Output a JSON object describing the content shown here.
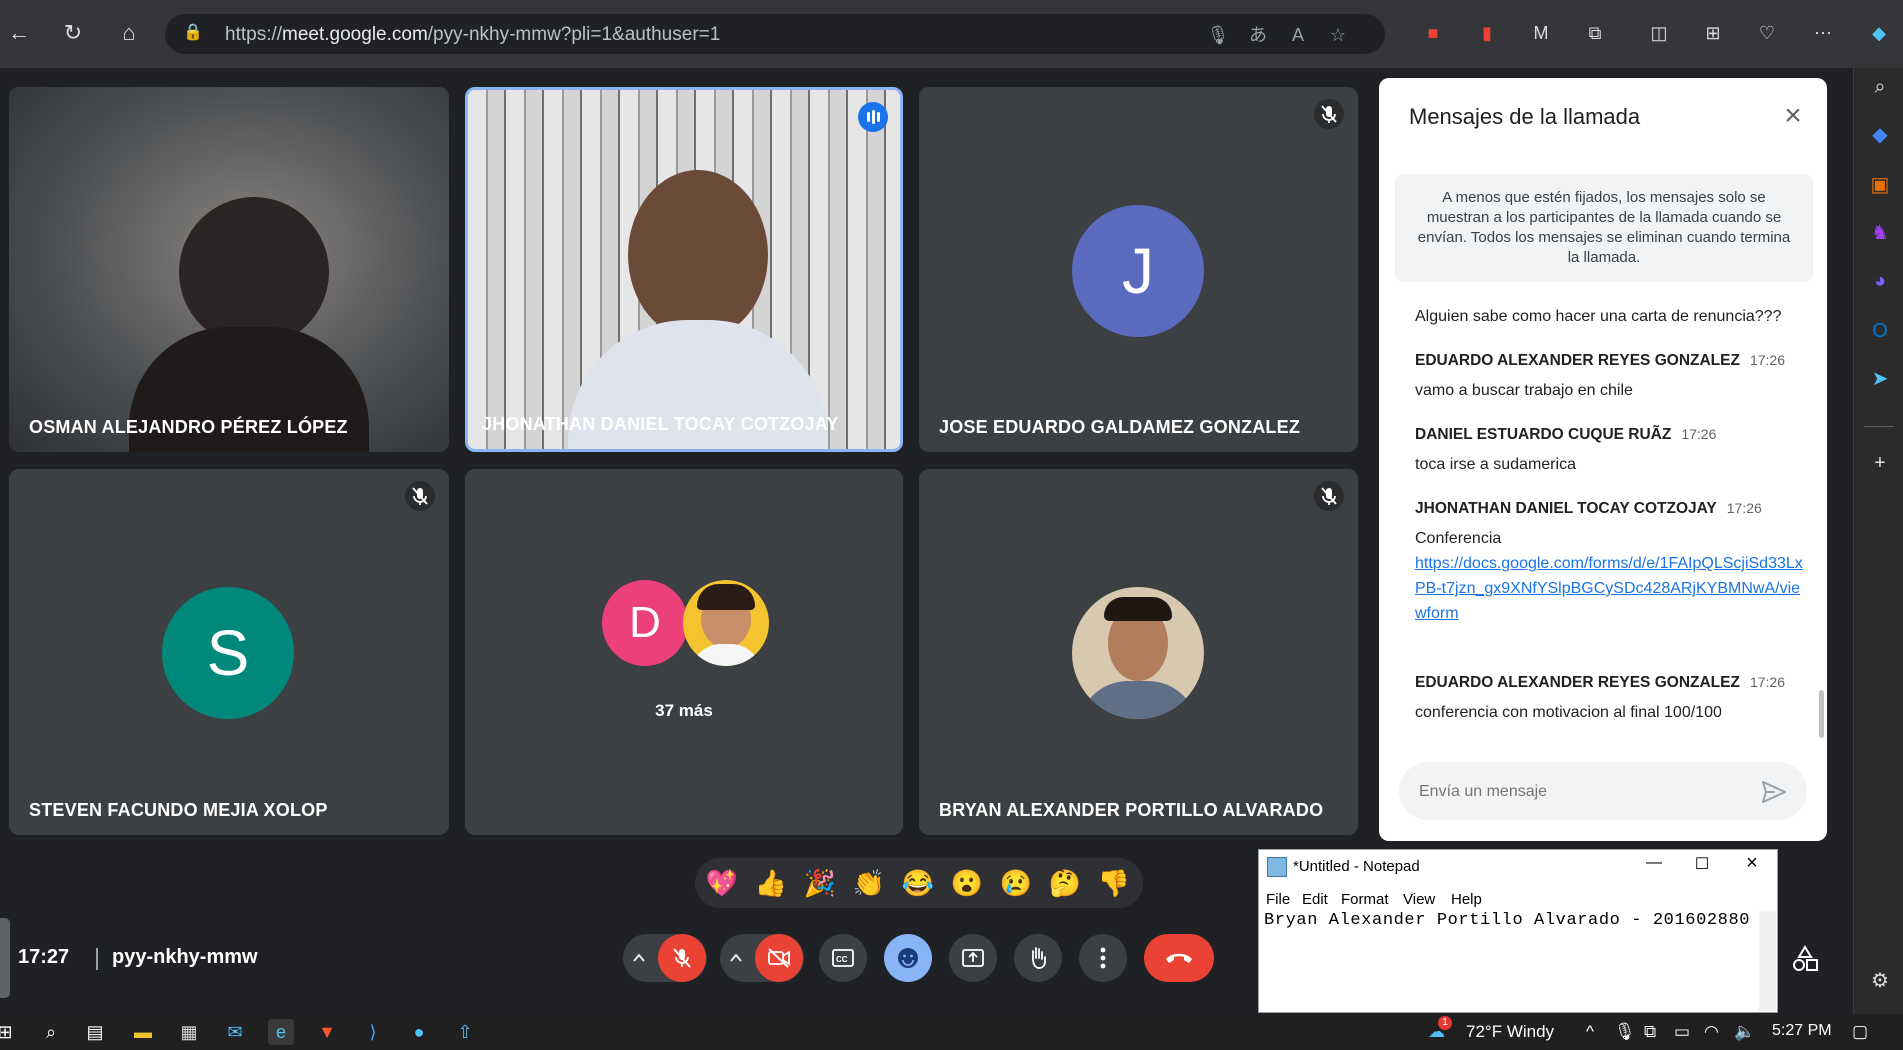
{
  "browser": {
    "url_prefix": "https://",
    "url_host": "meet.google.com",
    "url_path": "/pyy-nkhy-mmw?pli=1&authuser=1"
  },
  "participants": [
    {
      "name": "OSMAN ALEJANDRO PÉREZ LÓPEZ",
      "type": "video"
    },
    {
      "name": "JHONATHAN DANIEL TOCAY COTZOJAY",
      "type": "video",
      "speaking": true
    },
    {
      "name": "JOSE EDUARDO GALDAMEZ GONZALEZ",
      "type": "avatar",
      "initial": "J",
      "color": "#5c6bc0",
      "muted": true
    },
    {
      "name": "STEVEN FACUNDO MEJIA XOLOP",
      "type": "avatar",
      "initial": "S",
      "color": "#00897b",
      "muted": true
    },
    {
      "name": "",
      "type": "group",
      "initial": "D",
      "color": "#ec407a",
      "more_label": "37 más"
    },
    {
      "name": "BRYAN ALEXANDER PORTILLO ALVARADO",
      "type": "photo",
      "muted": true
    }
  ],
  "chat": {
    "title": "Mensajes de la llamada",
    "notice": "A menos que estén fijados, los mensajes solo se muestran a los participantes de la llamada cuando se envían. Todos los mensajes se eliminan cuando termina la llamada.",
    "first_message": "Alguien sabe como hacer una carta de renuncia???",
    "messages": [
      {
        "sender": "EDUARDO ALEXANDER REYES GONZALEZ",
        "time": "17:26",
        "text": "vamo a buscar trabajo en chile"
      },
      {
        "sender": "DANIEL ESTUARDO CUQUE RUÃZ",
        "time": "17:26",
        "text": "toca irse a sudamerica"
      },
      {
        "sender": "JHONATHAN DANIEL TOCAY COTZOJAY",
        "time": "17:26",
        "text": "Conferencia",
        "link": "https://docs.google.com/forms/d/e/1FAIpQLScjiSd33LxPB-t7jzn_gx9XNfYSlpBGCySDc428ARjKYBMNwA/viewform"
      },
      {
        "sender": "EDUARDO ALEXANDER REYES GONZALEZ",
        "time": "17:26",
        "text": "conferencia con motivacion al final 100/100"
      }
    ],
    "input_placeholder": "Envía un mensaje"
  },
  "reactions": [
    "💖",
    "👍",
    "🎉",
    "👏",
    "😂",
    "😮",
    "😢",
    "🤔",
    "👎"
  ],
  "meeting": {
    "time": "17:27",
    "code": "pyy-nkhy-mmw"
  },
  "notepad": {
    "title": "*Untitled - Notepad",
    "menu": [
      "File",
      "Edit",
      "Format",
      "View",
      "Help"
    ],
    "content": "Bryan Alexander Portillo Alvarado - 201602880"
  },
  "taskbar": {
    "weather": "72°F  Windy",
    "clock": "5:27 PM"
  }
}
